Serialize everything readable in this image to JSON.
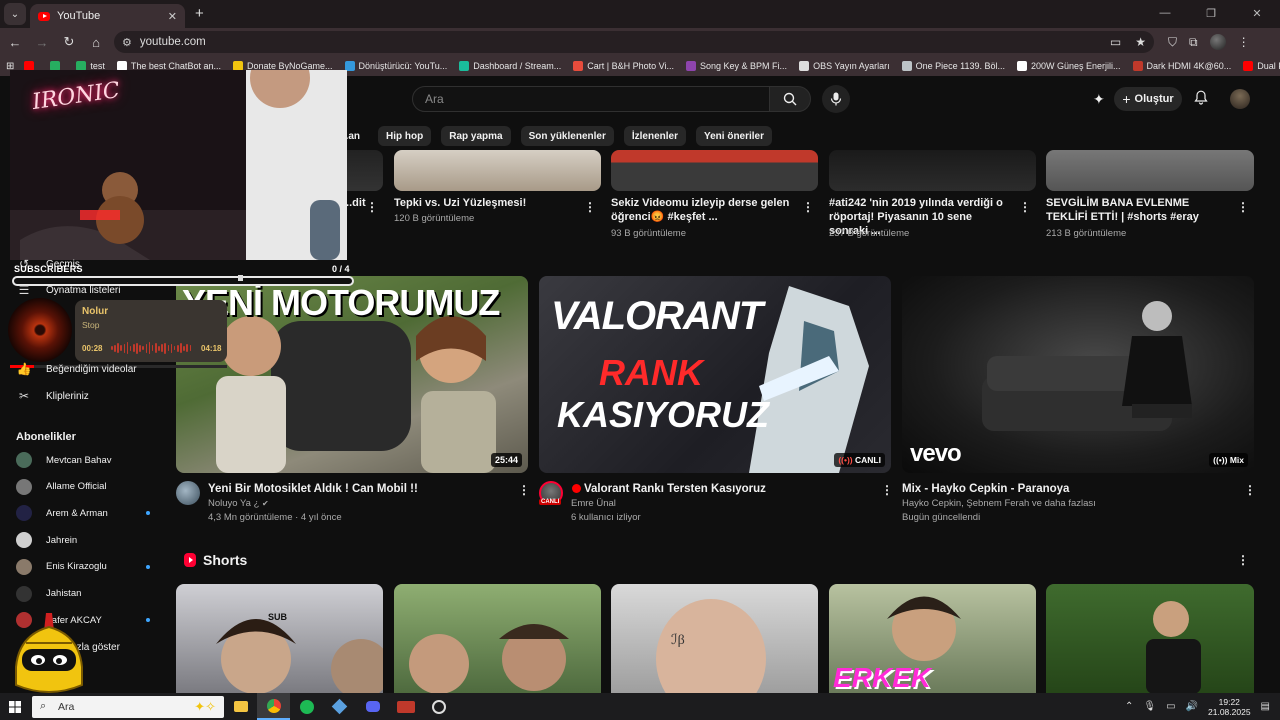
{
  "browser": {
    "tab_title": "YouTube",
    "url": "youtube.com",
    "bookmarks": [
      {
        "label": "",
        "color": "#ff0000"
      },
      {
        "label": "",
        "color": "#27ae60"
      },
      {
        "label": "test",
        "color": "#27ae60"
      },
      {
        "label": "The best ChatBot an...",
        "color": "#ffffff"
      },
      {
        "label": "Donate ByNoGame...",
        "color": "#f1c40f"
      },
      {
        "label": "Dönüştürücü: YouTu...",
        "color": "#3498db"
      },
      {
        "label": "Dashboard / Stream...",
        "color": "#1abc9c"
      },
      {
        "label": "Cart | B&H Photo Vi...",
        "color": "#e74c3c"
      },
      {
        "label": "Song Key & BPM Fi...",
        "color": "#8e44ad"
      },
      {
        "label": "OBS Yayın Ayarları",
        "color": "#dddddd"
      },
      {
        "label": "One Piece 1139. Böl...",
        "color": "#bdc3c7"
      },
      {
        "label": "200W Güneş Enerjili...",
        "color": "#ffffff"
      },
      {
        "label": "Dark HDMI 4K@60...",
        "color": "#c0392b"
      },
      {
        "label": "Dual PC Audio Setu...",
        "color": "#ff0000"
      }
    ]
  },
  "header": {
    "search_placeholder": "Ara",
    "create_label": "Oluştur"
  },
  "chips": [
    "...an",
    "Hip hop",
    "Rap yapma",
    "Son yüklenenler",
    "İzlenenler",
    "Yeni öneriler"
  ],
  "sidebar": {
    "items": [
      {
        "label": "Geçmiş",
        "icon": "history-icon"
      },
      {
        "label": "Oynatma listeleri",
        "icon": "playlist-icon"
      },
      {
        "label": "Beğendiğim videolar",
        "icon": "like-icon"
      },
      {
        "label": "Klipleriniz",
        "icon": "scissors-icon"
      }
    ],
    "subs_heading": "Abonelikler",
    "subscriptions": [
      {
        "name": "Mevtcan Bahav",
        "color": "#4a6b5a",
        "live": false
      },
      {
        "name": "Allame Official",
        "color": "#777777",
        "live": false
      },
      {
        "name": "Arem & Arman",
        "color": "#222244",
        "live": true
      },
      {
        "name": "Jahrein",
        "color": "#cfcfcf",
        "live": false
      },
      {
        "name": "Enis Kirazoglu",
        "color": "#8a7a6a",
        "live": true
      },
      {
        "name": "Jahistan",
        "color": "#333333",
        "live": false
      },
      {
        "name": "Zafer AKCAY",
        "color": "#b03030",
        "live": true
      }
    ],
    "show_more": "...ha fazla göster"
  },
  "top_row": [
    {
      "title": "...dit",
      "meta": ""
    },
    {
      "title": "Tepki vs. Uzi Yüzleşmesi!",
      "meta": "120 B görüntüleme"
    },
    {
      "title": "Sekiz Videomu izleyip derse gelen öğrenci😡 #keşfet ...",
      "meta": "93 B görüntüleme"
    },
    {
      "title": "#ati242 'nin 2019 yılında verdiği o röportaj! Piyasanın 10 sene sonraki ...",
      "meta": "237 B görüntüleme"
    },
    {
      "title": "SEVGİLİM BANA EVLENME TEKLİFİ ETTİ! | #shorts #eray",
      "meta": "213 B görüntüleme"
    }
  ],
  "videos": [
    {
      "thumb_text": "YENİ MOTORUMUZ",
      "duration": "25:44",
      "title": "Yeni Bir Motosiklet Aldık ! Can Mobil !!",
      "channel": "Noluyo Ya ¿",
      "meta": "4,3 Mn görüntüleme · 4 yıl önce"
    },
    {
      "thumb_text_1": "VALORANT",
      "thumb_text_2": "RANK",
      "thumb_text_3": "KASIYORUZ",
      "badge": "CANLI",
      "title": "Valorant Rankı Tersten Kasıyoruz",
      "channel": "Emre Ünal",
      "meta": "6 kullanıcı izliyor",
      "avatar_badge": "CANLI"
    },
    {
      "thumb_text": "vevo",
      "badge": "Mix",
      "title": "Mix - Hayko Cepkin - Paranoya",
      "channel": "Hayko Cepkin, Şebnem Ferah ve daha fazlası",
      "meta": "Bugün güncellendi"
    }
  ],
  "shorts": {
    "title": "Shorts",
    "thumbs": [
      {
        "text": "SUB"
      },
      {
        "text": ""
      },
      {
        "text": ""
      },
      {
        "text": "ERKEK"
      },
      {
        "text": ""
      }
    ]
  },
  "stream_overlay": {
    "webcam_sign": "IRONIC",
    "subs_label": "SUBSCRIBERS",
    "subs_count": "0 / 4",
    "now_playing_title": "Nolur",
    "now_playing_artist": "Stop",
    "elapsed": "00:28",
    "total": "04:18",
    "progress": 0.11
  },
  "taskbar": {
    "search_placeholder": "Ara",
    "time": "19:22",
    "date": "21.08.2025"
  },
  "colors": {
    "bg": "#0f0f0f",
    "accent_red": "#ff0000",
    "live_red": "#ff4e45",
    "sub_blue": "#3ea6ff"
  }
}
